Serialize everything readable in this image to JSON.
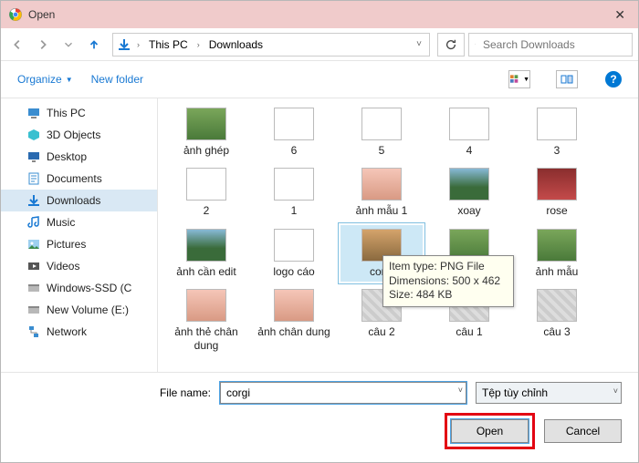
{
  "window": {
    "title": "Open"
  },
  "breadcrumb": {
    "root": "This PC",
    "folder": "Downloads"
  },
  "search": {
    "placeholder": "Search Downloads"
  },
  "cmdbar": {
    "organize": "Organize",
    "newfolder": "New folder"
  },
  "sidebar": {
    "items": [
      {
        "icon": "pc",
        "label": "This PC"
      },
      {
        "icon": "cube",
        "label": "3D Objects"
      },
      {
        "icon": "desktop",
        "label": "Desktop"
      },
      {
        "icon": "doc",
        "label": "Documents"
      },
      {
        "icon": "down",
        "label": "Downloads",
        "selected": true
      },
      {
        "icon": "music",
        "label": "Music"
      },
      {
        "icon": "pic",
        "label": "Pictures"
      },
      {
        "icon": "video",
        "label": "Videos"
      },
      {
        "icon": "drive",
        "label": "Windows-SSD (C"
      },
      {
        "icon": "drive",
        "label": "New Volume (E:)"
      },
      {
        "icon": "net",
        "label": "Network"
      }
    ]
  },
  "files": [
    {
      "name": "ảnh ghép",
      "thumb": "green"
    },
    {
      "name": "6",
      "thumb": "white"
    },
    {
      "name": "5",
      "thumb": "white"
    },
    {
      "name": "4",
      "thumb": "white"
    },
    {
      "name": "3",
      "thumb": "white"
    },
    {
      "name": "2",
      "thumb": "white"
    },
    {
      "name": "1",
      "thumb": "white"
    },
    {
      "name": "ảnh mẫu 1",
      "thumb": "face"
    },
    {
      "name": "xoay",
      "thumb": "sky"
    },
    {
      "name": "rose",
      "thumb": "red"
    },
    {
      "name": "ảnh cần edit",
      "thumb": "sky"
    },
    {
      "name": "logo cáo",
      "thumb": "white"
    },
    {
      "name": "corgi",
      "thumb": "dog",
      "selected": true,
      "highlight": true
    },
    {
      "name": "ảnh mau",
      "thumb": "green"
    },
    {
      "name": "ảnh mẫu",
      "thumb": "green"
    },
    {
      "name": "ảnh thẻ chân dung",
      "thumb": "face"
    },
    {
      "name": "ảnh chân dung",
      "thumb": "face"
    },
    {
      "name": "câu 2",
      "thumb": "unk"
    },
    {
      "name": "câu 1",
      "thumb": "unk"
    },
    {
      "name": "câu 3",
      "thumb": "unk"
    }
  ],
  "tooltip": {
    "l1_label": "Item type:",
    "l1_val": "PNG File",
    "l2_label": "Dimensions:",
    "l2_val": "500 x 462",
    "l3_label": "Size:",
    "l3_val": "484 KB"
  },
  "bottom": {
    "filename_label": "File name:",
    "filename_value": "corgi",
    "filter": "Tệp tùy chỉnh",
    "open": "Open",
    "cancel": "Cancel"
  }
}
